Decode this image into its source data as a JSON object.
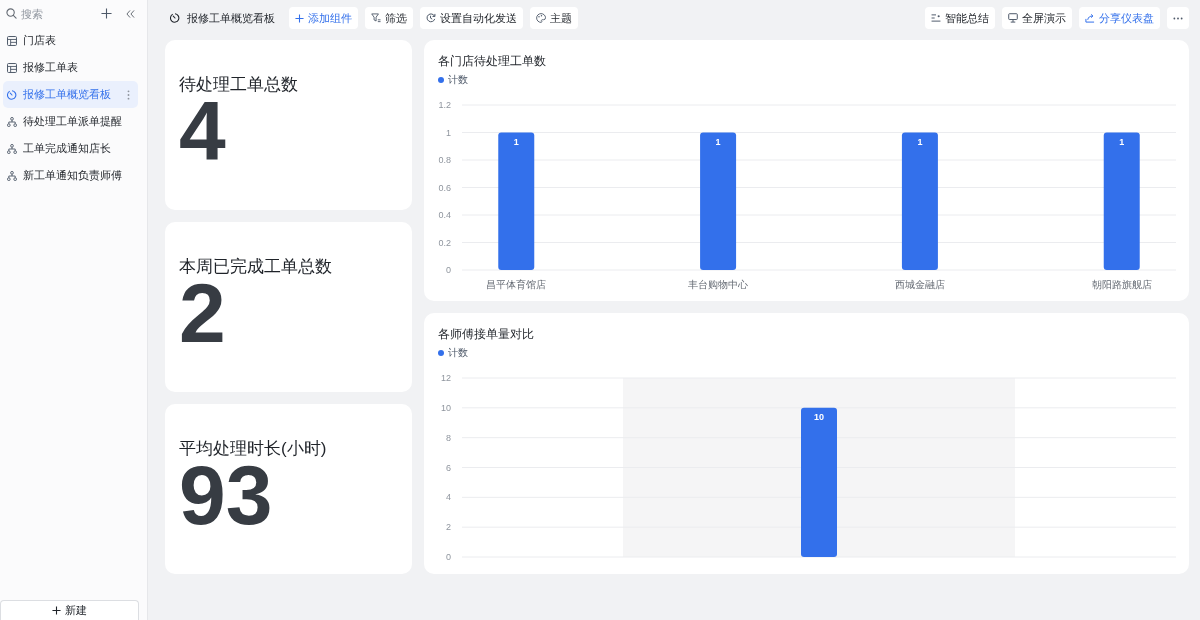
{
  "sidebar": {
    "search": {
      "placeholder": "搜索"
    },
    "items": [
      {
        "label": "门店表",
        "kind": "table",
        "selected": false
      },
      {
        "label": "报修工单表",
        "kind": "table",
        "selected": false
      },
      {
        "label": "报修工单概览看板",
        "kind": "dashboard",
        "selected": true
      },
      {
        "label": "待处理工单派单提醒",
        "kind": "workflow",
        "selected": false
      },
      {
        "label": "工单完成通知店长",
        "kind": "workflow",
        "selected": false
      },
      {
        "label": "新工单通知负责师傅",
        "kind": "workflow",
        "selected": false
      }
    ],
    "new_button": "新建"
  },
  "toolbar": {
    "title": "报修工单概览看板",
    "left_buttons": [
      {
        "label": "添加组件",
        "kind": "add"
      },
      {
        "label": "筛选",
        "kind": "filter"
      },
      {
        "label": "设置自动化发送",
        "kind": "automation"
      },
      {
        "label": "主题",
        "kind": "theme"
      }
    ],
    "right_buttons": [
      {
        "label": "智能总结",
        "kind": "summary"
      },
      {
        "label": "全屏演示",
        "kind": "present"
      },
      {
        "label": "分享仪表盘",
        "kind": "share"
      },
      {
        "kind": "more"
      }
    ]
  },
  "stats": [
    {
      "title": "待处理工单总数",
      "value": "4"
    },
    {
      "title": "本周已完成工单总数",
      "value": "2"
    },
    {
      "title": "平均处理时长(小时)",
      "value": "93"
    }
  ],
  "charts": [
    {
      "hovered": false,
      "chart_data": {
        "type": "bar",
        "title": "各门店待处理工单数",
        "categories": [
          "昌平体育馆店",
          "丰台购物中心",
          "西城金融店",
          "朝阳路旗舰店"
        ],
        "series": [
          {
            "name": "计数",
            "color": "#3370eb",
            "values": [
              1,
              1,
              1,
              1
            ]
          }
        ],
        "ylim": [
          0,
          1.2
        ],
        "yticks": [
          0,
          0.2,
          0.4,
          0.6,
          0.8,
          1,
          1.2
        ],
        "grid": true,
        "data_labels": true
      }
    },
    {
      "hovered": true,
      "chart_data": {
        "type": "bar",
        "title": "各师傅接单量对比",
        "series": [
          {
            "name": "计数",
            "color": "#3370eb",
            "values": [
              10
            ]
          }
        ],
        "ylim": [
          0,
          12
        ],
        "yticks": [
          0,
          2,
          4,
          6,
          8,
          10,
          12
        ],
        "grid": true,
        "data_labels": true
      }
    }
  ]
}
